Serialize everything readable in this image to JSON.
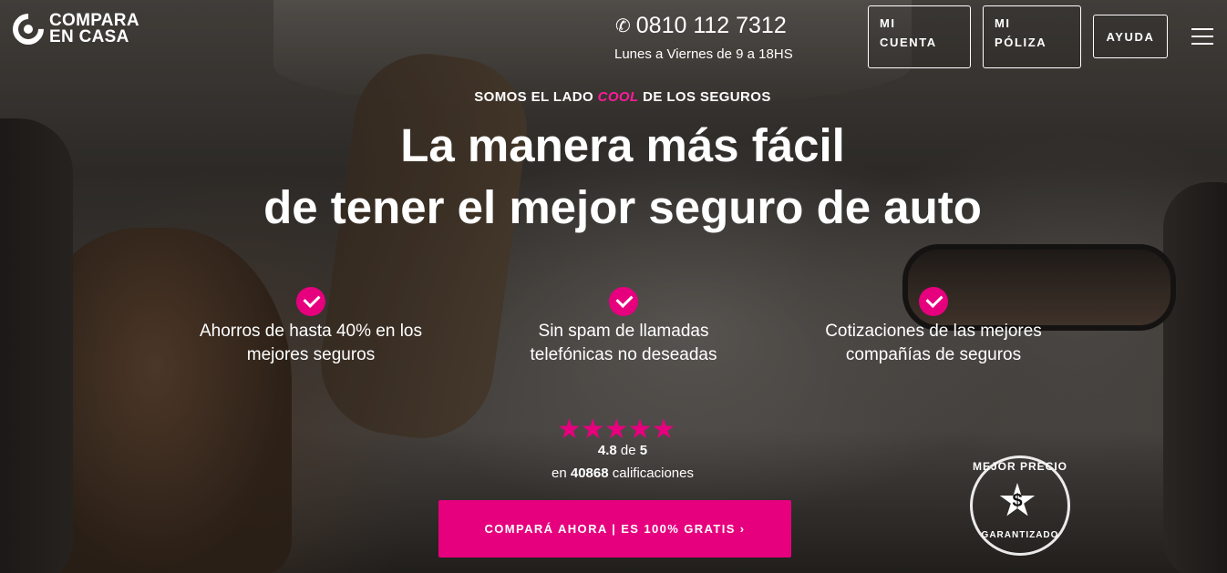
{
  "header": {
    "logo_line1": "COMPARA",
    "logo_line2": "EN CASA",
    "phone": "0810 112 7312",
    "hours": "Lunes a Viernes de 9 a 18HS",
    "buttons": {
      "mi_cuenta_line1": "MI",
      "mi_cuenta_line2": "CUENTA",
      "mi_poliza_line1": "MI",
      "mi_poliza_line2": "PÓLIZA",
      "ayuda": "AYUDA"
    }
  },
  "hero": {
    "tagline_pre": "SOMOS EL LADO",
    "tagline_cool": "COOL",
    "tagline_post": "DE LOS SEGUROS",
    "title_line1": "La manera más fácil",
    "title_line2": "de tener el mejor seguro de auto"
  },
  "features": [
    {
      "line1": "Ahorros de hasta 40% en los",
      "line2": "mejores seguros"
    },
    {
      "line1": "Sin spam de llamadas",
      "line2": "telefónicas no deseadas"
    },
    {
      "line1": "Cotizaciones de las mejores",
      "line2": "compañías de seguros"
    }
  ],
  "rating": {
    "stars": "★★★★★",
    "score": "4.8",
    "of": "de",
    "max": "5",
    "count_pre": "en",
    "count": "40868",
    "count_post": "calificaciones"
  },
  "cta": {
    "label": "COMPARÁ AHORA | ES 100% GRATIS ›"
  },
  "badge": {
    "top": "MEJOR PRECIO",
    "bottom": "GARANTIZADO",
    "symbol": "$"
  },
  "colors": {
    "accent": "#e6007e",
    "cool_text": "#ff1a9b"
  }
}
